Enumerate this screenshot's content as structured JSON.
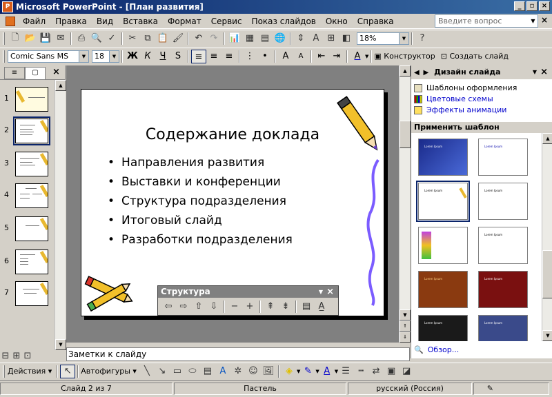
{
  "window": {
    "title": "Microsoft PowerPoint - [План развития]"
  },
  "menu": {
    "items": [
      "Файл",
      "Правка",
      "Вид",
      "Вставка",
      "Формат",
      "Сервис",
      "Показ слайдов",
      "Окно",
      "Справка"
    ],
    "help_placeholder": "Введите вопрос"
  },
  "toolbar": {
    "zoom": "18%"
  },
  "format": {
    "font": "Comic Sans MS",
    "size": "18",
    "bold": "Ж",
    "italic": "К",
    "underline": "Ч",
    "designer": "Конструктор",
    "new_slide": "Создать слайд"
  },
  "slides": {
    "numbers": [
      "1",
      "2",
      "3",
      "4",
      "5",
      "6",
      "7"
    ],
    "selected": 2
  },
  "slide": {
    "title": "Содержание доклада",
    "bullets": [
      "Направления развития",
      "Выставки и конференции",
      "Структура подразделения",
      "Итоговый слайд",
      "Разработки подразделения"
    ]
  },
  "structure_toolbar": {
    "title": "Структура"
  },
  "task_pane": {
    "title": "Дизайн слайда",
    "links": [
      "Шаблоны оформления",
      "Цветовые схемы",
      "Эффекты анимации"
    ],
    "apply_label": "Применить шаблон оформления:",
    "template_text": "Lorem Ipsum",
    "browse": "Обзор..."
  },
  "notes": {
    "placeholder": "Заметки к слайду"
  },
  "drawing": {
    "actions": "Действия",
    "autoshapes": "Автофигуры"
  },
  "status": {
    "slide": "Слайд 2 из 7",
    "design": "Пастель",
    "language": "русский (Россия)"
  },
  "colors": {
    "titlebar": "#0a246a",
    "chrome": "#d4d0c8",
    "link": "#0000cc"
  }
}
